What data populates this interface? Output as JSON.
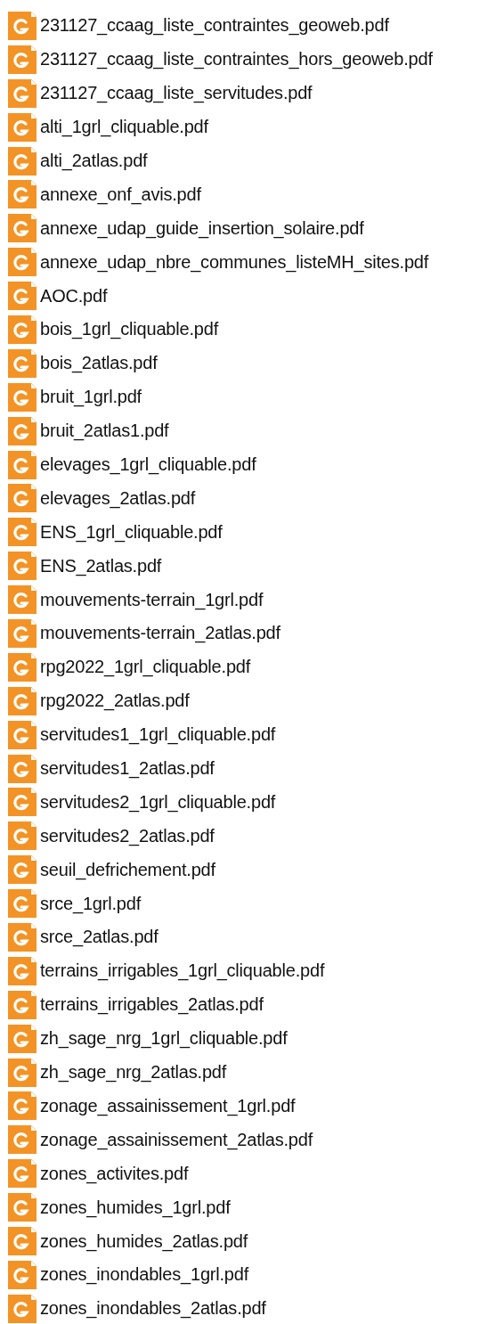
{
  "files": [
    {
      "name": "231127_ccaag_liste_contraintes_geoweb.pdf"
    },
    {
      "name": "231127_ccaag_liste_contraintes_hors_geoweb.pdf"
    },
    {
      "name": "231127_ccaag_liste_servitudes.pdf"
    },
    {
      "name": "alti_1grl_cliquable.pdf"
    },
    {
      "name": "alti_2atlas.pdf"
    },
    {
      "name": "annexe_onf_avis.pdf"
    },
    {
      "name": "annexe_udap_guide_insertion_solaire.pdf"
    },
    {
      "name": "annexe_udap_nbre_communes_listeMH_sites.pdf"
    },
    {
      "name": "AOC.pdf"
    },
    {
      "name": "bois_1grl_cliquable.pdf"
    },
    {
      "name": "bois_2atlas.pdf"
    },
    {
      "name": "bruit_1grl.pdf"
    },
    {
      "name": "bruit_2atlas1.pdf"
    },
    {
      "name": "elevages_1grl_cliquable.pdf"
    },
    {
      "name": "elevages_2atlas.pdf"
    },
    {
      "name": "ENS_1grl_cliquable.pdf"
    },
    {
      "name": "ENS_2atlas.pdf"
    },
    {
      "name": "mouvements-terrain_1grl.pdf"
    },
    {
      "name": "mouvements-terrain_2atlas.pdf"
    },
    {
      "name": "rpg2022_1grl_cliquable.pdf"
    },
    {
      "name": "rpg2022_2atlas.pdf"
    },
    {
      "name": "servitudes1_1grl_cliquable.pdf"
    },
    {
      "name": "servitudes1_2atlas.pdf"
    },
    {
      "name": "servitudes2_1grl_cliquable.pdf"
    },
    {
      "name": "servitudes2_2atlas.pdf"
    },
    {
      "name": "seuil_defrichement.pdf"
    },
    {
      "name": "srce_1grl.pdf"
    },
    {
      "name": "srce_2atlas.pdf"
    },
    {
      "name": "terrains_irrigables_1grl_cliquable.pdf"
    },
    {
      "name": "terrains_irrigables_2atlas.pdf"
    },
    {
      "name": "zh_sage_nrg_1grl_cliquable.pdf"
    },
    {
      "name": "zh_sage_nrg_2atlas.pdf"
    },
    {
      "name": "zonage_assainissement_1grl.pdf"
    },
    {
      "name": "zonage_assainissement_2atlas.pdf"
    },
    {
      "name": "zones_activites.pdf"
    },
    {
      "name": "zones_humides_1grl.pdf"
    },
    {
      "name": "zones_humides_2atlas.pdf"
    },
    {
      "name": "zones_inondables_1grl.pdf"
    },
    {
      "name": "zones_inondables_2atlas.pdf"
    }
  ]
}
